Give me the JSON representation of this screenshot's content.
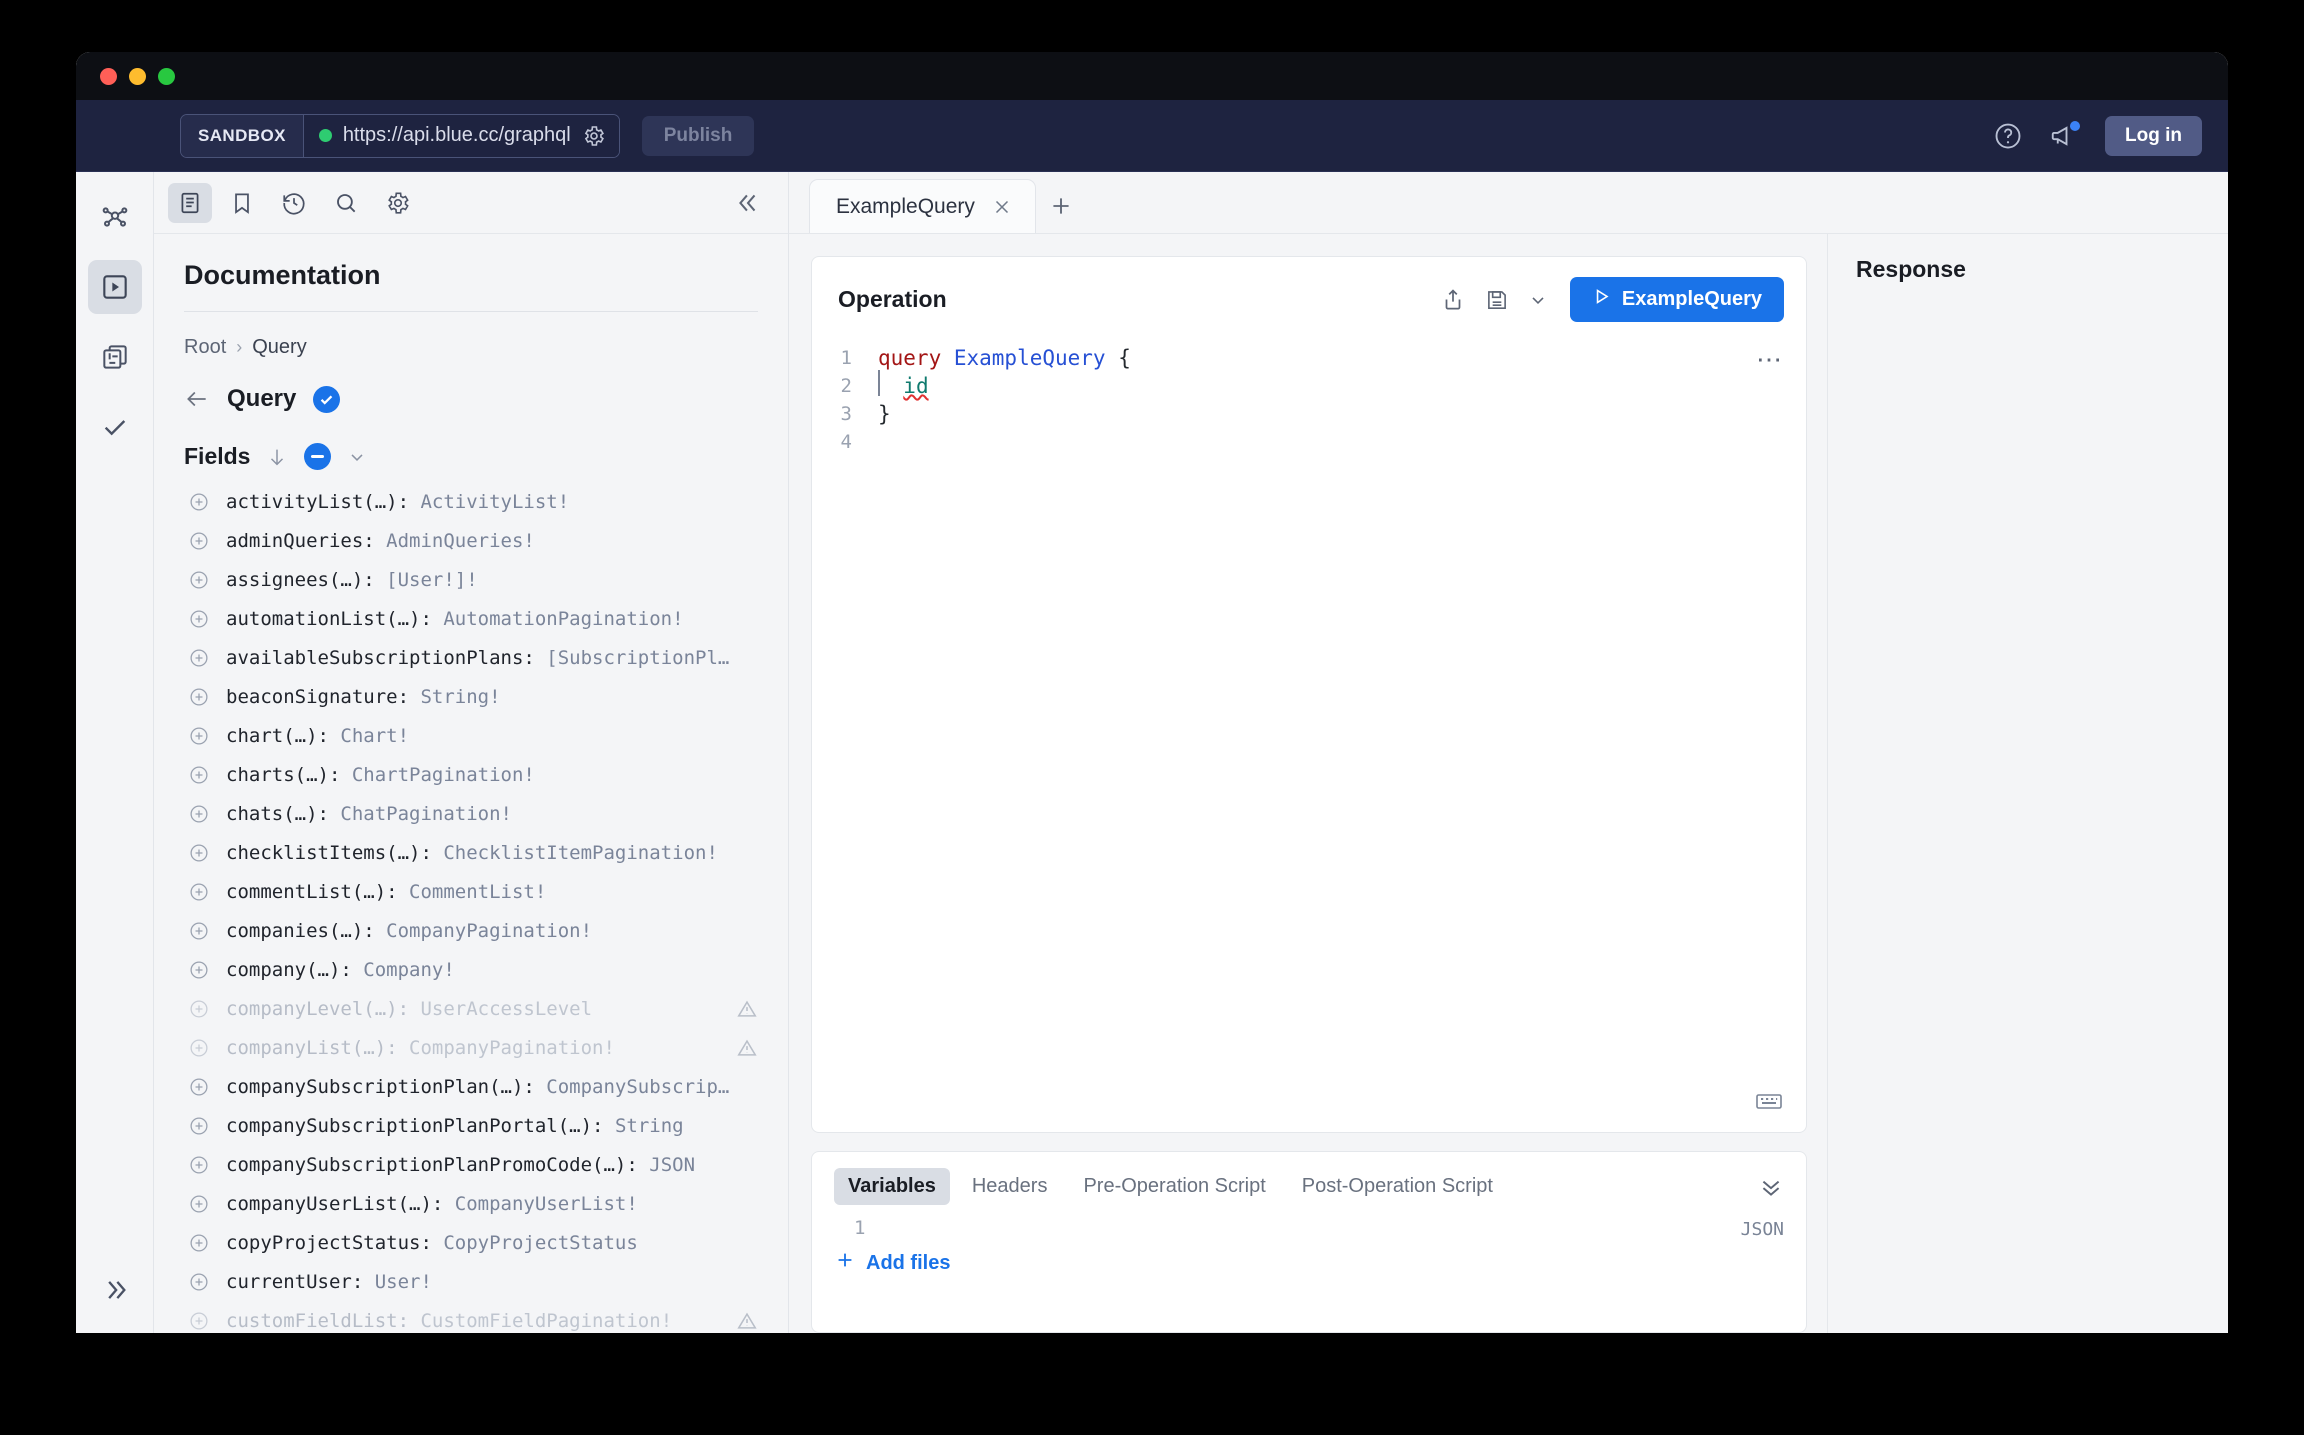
{
  "appbar": {
    "sandbox_label": "SANDBOX",
    "url": "https://api.blue.cc/graphql",
    "status_dot_color": "#2ecc71",
    "publish_label": "Publish",
    "login_label": "Log in",
    "accent_color": "#1a73e8"
  },
  "rail": {
    "items": [
      {
        "icon": "graph-network-icon",
        "name": "logo"
      },
      {
        "icon": "play-box-icon",
        "name": "operations",
        "active": true
      },
      {
        "icon": "documents-diff-icon",
        "name": "collections"
      },
      {
        "icon": "check-icon",
        "name": "checks"
      }
    ],
    "expand_icon": "chevrons-right-icon"
  },
  "doc_toolbar": {
    "items": [
      {
        "icon": "book-icon",
        "name": "documentation",
        "active": true
      },
      {
        "icon": "bookmark-icon",
        "name": "bookmarks"
      },
      {
        "icon": "history-icon",
        "name": "history"
      },
      {
        "icon": "search-icon",
        "name": "search"
      },
      {
        "icon": "gear-icon",
        "name": "settings"
      }
    ],
    "collapse_icon": "chevrons-left-icon"
  },
  "documentation": {
    "title": "Documentation",
    "breadcrumb": {
      "root": "Root",
      "separator": "›",
      "current": "Query"
    },
    "type_name": "Query",
    "fields_label": "Fields",
    "fields": [
      {
        "name": "activityList(…):",
        "type": "ActivityList!",
        "deprecated": false
      },
      {
        "name": "adminQueries:",
        "type": "AdminQueries!",
        "deprecated": false
      },
      {
        "name": "assignees(…):",
        "type": "[User!]!",
        "deprecated": false
      },
      {
        "name": "automationList(…):",
        "type": "AutomationPagination!",
        "deprecated": false
      },
      {
        "name": "availableSubscriptionPlans:",
        "type": "[SubscriptionPl…",
        "deprecated": false
      },
      {
        "name": "beaconSignature:",
        "type": "String!",
        "deprecated": false
      },
      {
        "name": "chart(…):",
        "type": "Chart!",
        "deprecated": false
      },
      {
        "name": "charts(…):",
        "type": "ChartPagination!",
        "deprecated": false
      },
      {
        "name": "chats(…):",
        "type": "ChatPagination!",
        "deprecated": false
      },
      {
        "name": "checklistItems(…):",
        "type": "ChecklistItemPagination!",
        "deprecated": false
      },
      {
        "name": "commentList(…):",
        "type": "CommentList!",
        "deprecated": false
      },
      {
        "name": "companies(…):",
        "type": "CompanyPagination!",
        "deprecated": false
      },
      {
        "name": "company(…):",
        "type": "Company!",
        "deprecated": false
      },
      {
        "name": "companyLevel(…):",
        "type": "UserAccessLevel",
        "deprecated": true
      },
      {
        "name": "companyList(…):",
        "type": "CompanyPagination!",
        "deprecated": true
      },
      {
        "name": "companySubscriptionPlan(…):",
        "type": "CompanySubscrip…",
        "deprecated": false
      },
      {
        "name": "companySubscriptionPlanPortal(…):",
        "type": "String",
        "deprecated": false
      },
      {
        "name": "companySubscriptionPlanPromoCode(…):",
        "type": "JSON",
        "deprecated": false
      },
      {
        "name": "companyUserList(…):",
        "type": "CompanyUserList!",
        "deprecated": false
      },
      {
        "name": "copyProjectStatus:",
        "type": "CopyProjectStatus",
        "deprecated": false
      },
      {
        "name": "currentUser:",
        "type": "User!",
        "deprecated": false
      },
      {
        "name": "customFieldList:",
        "type": "CustomFieldPagination!",
        "deprecated": true
      }
    ]
  },
  "tabs": {
    "items": [
      {
        "label": "ExampleQuery",
        "active": true
      }
    ],
    "add_label": "+"
  },
  "operation": {
    "title": "Operation",
    "run_label": "ExampleQuery",
    "run_icon": "play-icon",
    "share_icon": "share-icon",
    "save_icon": "save-icon",
    "more_icon": "ellipsis-icon",
    "keyboard_icon": "keyboard-icon",
    "code": [
      {
        "num": "1",
        "tokens": [
          {
            "t": "query ",
            "c": "kw"
          },
          {
            "t": "ExampleQuery",
            "c": "opname"
          },
          {
            "t": " {",
            "c": "brace"
          }
        ]
      },
      {
        "num": "2",
        "tokens": [
          {
            "t": "  ",
            "c": "brace"
          },
          {
            "t": "id",
            "c": "fieldtok"
          }
        ]
      },
      {
        "num": "3",
        "tokens": [
          {
            "t": "}",
            "c": "brace"
          }
        ]
      },
      {
        "num": "4",
        "tokens": []
      }
    ]
  },
  "variables": {
    "tabs": [
      {
        "label": "Variables",
        "active": true
      },
      {
        "label": "Headers",
        "active": false
      },
      {
        "label": "Pre-Operation Script",
        "active": false
      },
      {
        "label": "Post-Operation Script",
        "active": false
      }
    ],
    "collapse_icon": "chevrons-down-icon",
    "line_number": "1",
    "format_label": "JSON",
    "add_files_label": "Add files"
  },
  "response": {
    "title": "Response"
  }
}
